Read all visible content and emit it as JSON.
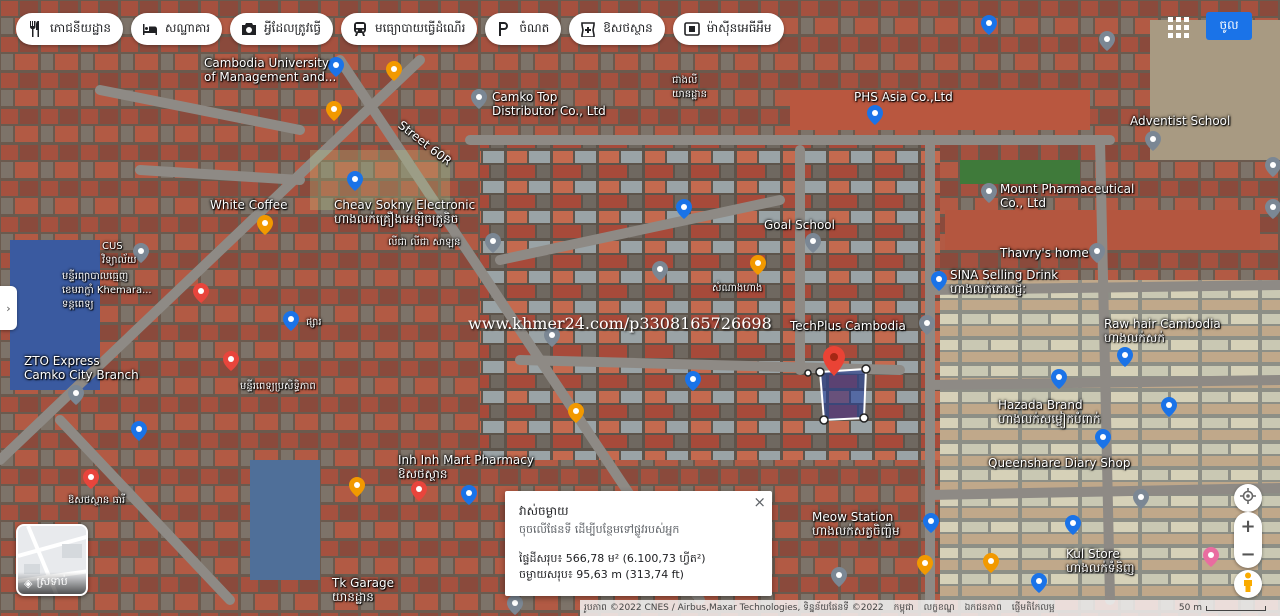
{
  "chips": [
    {
      "icon": "restaurant-icon",
      "label": "ភោជនីយដ្ឋាន"
    },
    {
      "icon": "hotel-icon",
      "label": "សណ្ឋាគារ"
    },
    {
      "icon": "camera-icon",
      "label": "អ្វីដែលត្រូវធ្វើ"
    },
    {
      "icon": "transit-icon",
      "label": "មធ្យោបាយធ្វើដំណើរ"
    },
    {
      "icon": "parking-icon",
      "label": "ចំណត"
    },
    {
      "icon": "pharmacy-icon",
      "label": "ឱសថស្ថាន"
    },
    {
      "icon": "atm-icon",
      "label": "ម៉ាស៊ីនអេធីអឹម"
    }
  ],
  "header": {
    "signin_label": "ចូល"
  },
  "labels": [
    {
      "name": "label-cambodia-university",
      "text": "Cambodia University\nof Management and..."
    },
    {
      "name": "label-camko-top",
      "text": "Camko Top\nDistributor Co., Ltd"
    },
    {
      "name": "label-chanlee",
      "text": "ជាងលី\nយានដ្ឋាន"
    },
    {
      "name": "label-phs-asia",
      "text": "PHS Asia Co.,Ltd"
    },
    {
      "name": "label-adventist-school",
      "text": "Adventist School"
    },
    {
      "name": "label-street-60r",
      "text": "Street 60R"
    },
    {
      "name": "label-white-coffee",
      "text": "White Coffee"
    },
    {
      "name": "label-cheav-sokny",
      "text": "Cheav Sokny Electronic\nហាងលក់គ្រឿងអេឡិចត្រូនិច"
    },
    {
      "name": "label-goal-school",
      "text": "Goal School"
    },
    {
      "name": "label-mount-pharma",
      "text": "Mount Pharmaceutical\nCo., Ltd"
    },
    {
      "name": "label-cus",
      "text": "CUS\nវិទ្យាល័យ"
    },
    {
      "name": "label-khemara",
      "text": "មន្ទីរព្យាបាលធ្មេញ\nខេមរាក្លាំ Khemara...\nទន្តពេទ្យ"
    },
    {
      "name": "label-lichy",
      "text": "លីជា លីជា សាឡន"
    },
    {
      "name": "label-thavry",
      "text": "Thavry's home"
    },
    {
      "name": "label-sina",
      "text": "SINA Selling Drink\nហាងលក់ភេសជ្ជៈ"
    },
    {
      "name": "label-techplus",
      "text": "TechPlus Cambodia"
    },
    {
      "name": "label-raw-hair",
      "text": "Raw hair Cambodia\nហាងលក់សក់"
    },
    {
      "name": "label-zto",
      "text": "ZTO Express\nCamko City Branch"
    },
    {
      "name": "label-hospital",
      "text": "មន្ទីរពេទ្យប្រសិទ្ធិភាព"
    },
    {
      "name": "label-hazada",
      "text": "Hazada Brand\nហាងលក់សម្លៀកបំពាក់"
    },
    {
      "name": "label-queenshare",
      "text": "Queenshare Diary Shop"
    },
    {
      "name": "label-inh-inh",
      "text": "Inh Inh Mart Pharmacy\nឱសថស្ថាន"
    },
    {
      "name": "label-meow-station",
      "text": "Meow Station\nហាងលក់សត្វចិញ្ចឹម"
    },
    {
      "name": "label-kul-store",
      "text": "Kul Store\nហាងលក់ទំនិញ"
    },
    {
      "name": "label-tk-garage",
      "text": "Tk Garage\nយានដ្ឋាន"
    },
    {
      "name": "label-pharmacy-left",
      "text": "ឱសថស្ថាន ធារី"
    },
    {
      "name": "label-market",
      "text": "ផ្សារ"
    },
    {
      "name": "label-samnang",
      "text": "សំណាងហាង"
    }
  ],
  "watermark": "www.khmer24.com/p3308165726698",
  "measure": {
    "title": "វាស់ចម្ងាយ",
    "hint": "ចុចលើផែនទី ដើម្បីបន្ថែមទៅផ្លូវរបស់អ្នក",
    "area": "ផ្ទៃដីសរុប៖ 566,78 ម² (6.100,73 ហ្វីត²)",
    "distance": "ចម្ងាយសរុប៖ 95,63 m (313,74 ft)",
    "close": "×"
  },
  "layers": {
    "label": "ស្រទាប់"
  },
  "footer": {
    "imagery": "រូបភាព ©2022 CNES / Airbus,Maxar Technologies, ទិន្នន័យផែនទី ©2022",
    "links": [
      "កម្ពុជា",
      "លក្ខខណ្ឌ",
      "ឯកជនភាព",
      "ផ្ញើមតិកែលម្អ"
    ],
    "scale": "50 m"
  }
}
